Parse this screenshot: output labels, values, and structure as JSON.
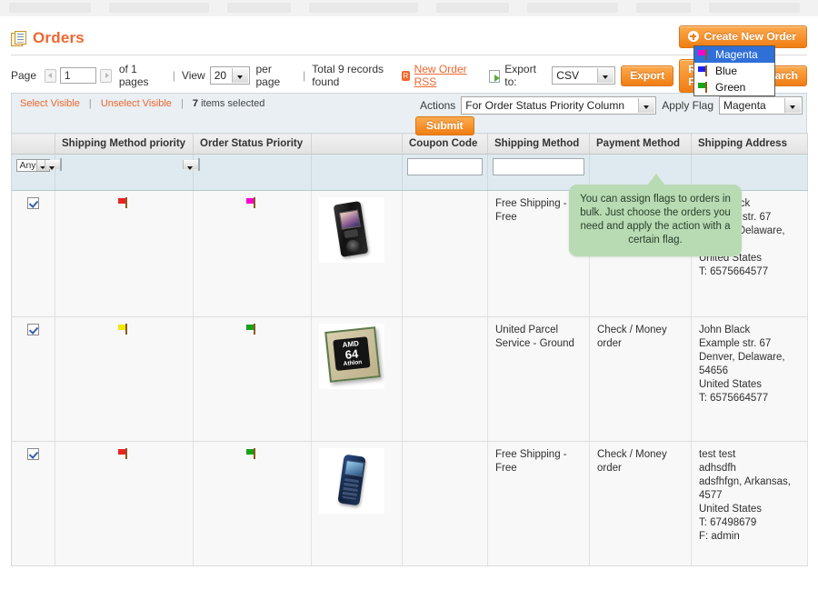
{
  "window": {
    "title": "Orders",
    "title_icon": "orders-page-icon"
  },
  "header": {
    "create_order_label": "Create New Order",
    "create_icon": "plus-circle-icon"
  },
  "toolbar": {
    "page_label": "Page",
    "page_value": "1",
    "of_pages": "of 1 pages",
    "sep1": "|",
    "view_label": "View",
    "view_value": "20",
    "per_page_label": "per page",
    "sep2": "|",
    "total_records": "Total 9 records found",
    "rss_icon_text": "R",
    "rss_link": "New Order RSS",
    "export_icon": "export-icon",
    "export_to_label": "Export to:",
    "export_format": "CSV",
    "export_button": "Export",
    "reset_filter_button": "Reset Filter",
    "search_button": "Search"
  },
  "massaction": {
    "select_visible": "Select Visible",
    "unselect_visible": "Unselect Visible",
    "divider": "|",
    "items_selected_count": "7",
    "items_selected_text": "items selected",
    "actions_label": "Actions",
    "actions_value": "For Order Status Priority Column",
    "apply_flag_label": "Apply Flag",
    "apply_flag_value": "Magenta",
    "submit_label": "Submit",
    "flag_options": [
      {
        "label": "Magenta",
        "color": "#ff00d0",
        "selected": true
      },
      {
        "label": "Blue",
        "color": "#2020ee",
        "selected": false
      },
      {
        "label": "Green",
        "color": "#16a616",
        "selected": false
      }
    ]
  },
  "tooltip": {
    "text": "You can assign flags to orders in bulk. Just choose the orders you need and apply the action with a certain flag."
  },
  "grid": {
    "columns": [
      {
        "label": "",
        "key": "checkbox"
      },
      {
        "label": "Shipping Method priority",
        "key": "shipping_priority"
      },
      {
        "label": "Order Status Priority",
        "key": "status_priority"
      },
      {
        "label": "",
        "key": "product"
      },
      {
        "label": "Coupon Code",
        "key": "coupon_code"
      },
      {
        "label": "Shipping Method",
        "key": "shipping_method"
      },
      {
        "label": "Payment Method",
        "key": "payment_method"
      },
      {
        "label": "Shipping Address",
        "key": "shipping_address"
      }
    ],
    "filters": {
      "checkbox_any": "Any",
      "shipping_priority": "",
      "status_priority": "",
      "coupon_code": "",
      "shipping_method": ""
    },
    "rows": [
      {
        "checked": true,
        "shipping_priority_flag": "#ee2222",
        "status_priority_flag": "#ff00d0",
        "product_image": "black-phone-thumbnail",
        "coupon_code": "",
        "shipping_method": "Free Shipping - Free",
        "payment_method": "",
        "shipping_address": "John Black\nExample str. 67\nDenver, Delaware, 54656\nUnited States\nT: 6575664577"
      },
      {
        "checked": true,
        "shipping_priority_flag": "#f2e700",
        "status_priority_flag": "#17a117",
        "product_image": "amd-athlon-cpu-thumbnail",
        "coupon_code": "",
        "shipping_method": "United Parcel Service - Ground",
        "payment_method": "Check / Money order",
        "shipping_address": "John Black\nExample str. 67\nDenver, Delaware, 54656\nUnited States\nT: 6575664577"
      },
      {
        "checked": true,
        "shipping_priority_flag": "#ee2222",
        "status_priority_flag": "#17a117",
        "product_image": "blue-phone-thumbnail",
        "coupon_code": "",
        "shipping_method": "Free Shipping - Free",
        "payment_method": "Check / Money order",
        "shipping_address": "test test\nadhsdfh\nadsfhfgn, Arkansas, 4577\nUnited States\nT: 67498679\nF: admin"
      }
    ]
  },
  "colors": {
    "accent": "#ef672f",
    "filter_row": "#dfeaf0",
    "tooltip_bg": "#b9dbb4",
    "dropdown_selected": "#2f6fd8"
  }
}
